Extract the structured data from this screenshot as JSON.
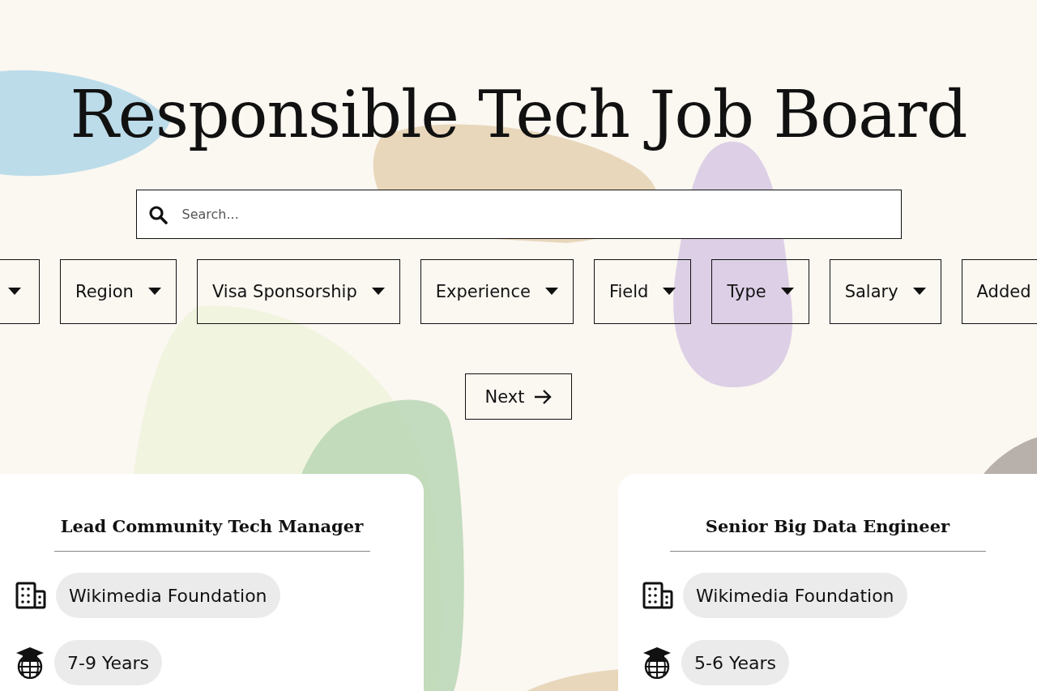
{
  "title": "Responsible Tech Job Board",
  "search": {
    "placeholder": "Search..."
  },
  "filters": [
    {
      "kind": "clipped"
    },
    {
      "kind": "dropdown",
      "label": "Region"
    },
    {
      "kind": "dropdown",
      "label": "Visa Sponsorship"
    },
    {
      "kind": "dropdown",
      "label": "Experience"
    },
    {
      "kind": "dropdown",
      "label": "Field"
    },
    {
      "kind": "dropdown",
      "label": "Type"
    },
    {
      "kind": "dropdown",
      "label": "Salary"
    },
    {
      "kind": "cut",
      "label": "Added"
    }
  ],
  "pagination": {
    "next": "Next"
  },
  "jobs": [
    {
      "title": "Lead Community Tech Manager",
      "company": "Wikimedia Foundation",
      "experience": "7-9 Years"
    },
    {
      "title": "Senior Big Data Engineer",
      "company": "Wikimedia Foundation",
      "experience": "5-6 Years"
    }
  ]
}
